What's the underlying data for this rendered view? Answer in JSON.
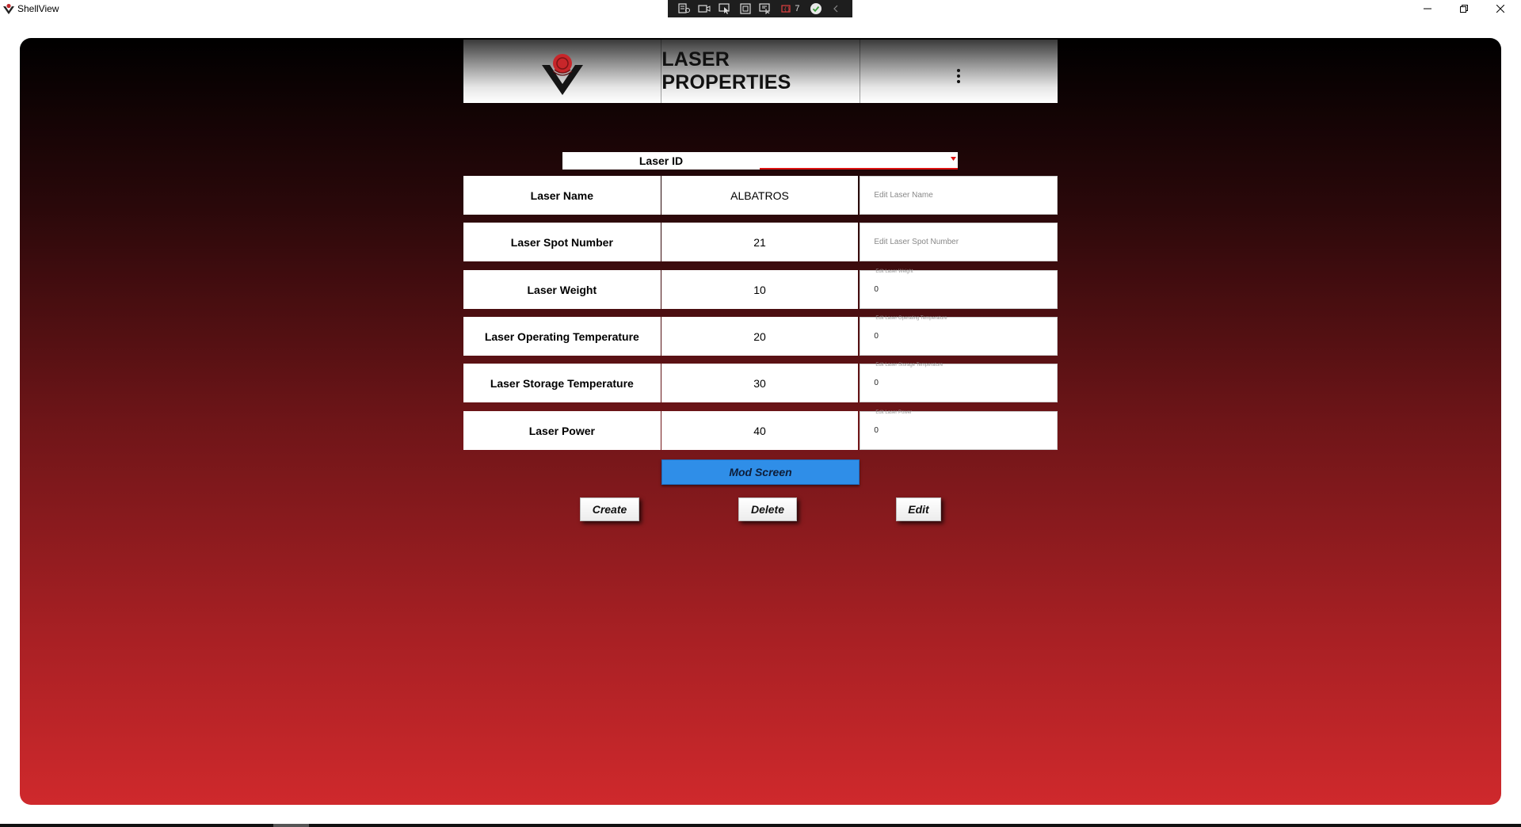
{
  "app": {
    "title": "ShellView"
  },
  "debug_toolbar": {
    "count": "7"
  },
  "header": {
    "title": "LASER PROPERTIES"
  },
  "laser_id": {
    "label": "Laser ID",
    "selected": ""
  },
  "rows": [
    {
      "label": "Laser Name",
      "value": "ALBATROS",
      "placeholder": "Edit Laser Name",
      "edit_value": "",
      "float_label": ""
    },
    {
      "label": "Laser Spot Number",
      "value": "21",
      "placeholder": "Edit Laser Spot Number",
      "edit_value": "",
      "float_label": ""
    },
    {
      "label": "Laser Weight",
      "value": "10",
      "placeholder": "",
      "edit_value": "0",
      "float_label": "Edit Laser Weight"
    },
    {
      "label": "Laser Operating Temperature",
      "value": "20",
      "placeholder": "",
      "edit_value": "0",
      "float_label": "Edit Laser Operating Temperature"
    },
    {
      "label": "Laser Storage Temperature",
      "value": "30",
      "placeholder": "",
      "edit_value": "0",
      "float_label": "Edit Laser Storage Temperature"
    },
    {
      "label": "Laser Power",
      "value": "40",
      "placeholder": "",
      "edit_value": "0",
      "float_label": "Edit Laser Power"
    }
  ],
  "buttons": {
    "mod_screen": "Mod Screen",
    "create": "Create",
    "delete": "Delete",
    "edit": "Edit"
  },
  "colors": {
    "accent": "#2f8ee8",
    "gradient_top": "#000000",
    "gradient_bottom": "#cf292c"
  }
}
